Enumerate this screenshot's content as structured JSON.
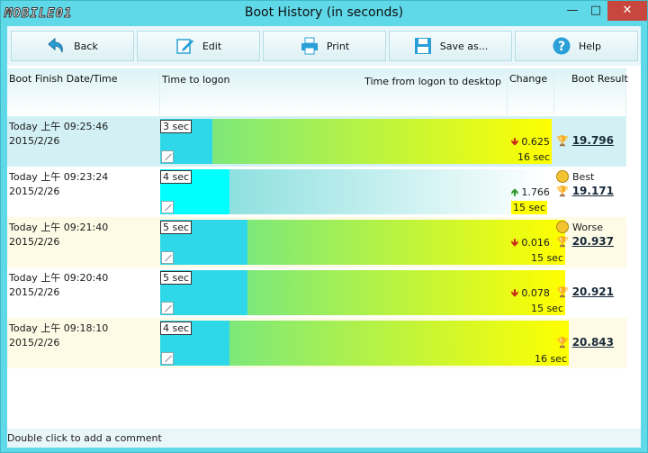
{
  "window": {
    "logo": "MOBILE01",
    "title": "Boot History (in seconds)",
    "min_glyph": "—",
    "max_glyph": "□",
    "close_glyph": "✕"
  },
  "toolbar": {
    "back_label": "Back",
    "edit_label": "Edit",
    "print_label": "Print",
    "save_label": "Save as...",
    "help_label": "Help"
  },
  "header": {
    "date_col": "Boot Finish Date/Time",
    "logon_col": "Time to logon",
    "desktop_col": "Time from logon to desktop",
    "change_col": "Change",
    "result_col": "Boot Result"
  },
  "rows": [
    {
      "day": "Today  上午  09:25:46",
      "date": "2015/2/26",
      "logon": "3 sec",
      "logon_sec": 3,
      "desktop": "16 sec",
      "desktop_sec": 16,
      "change": "0.625",
      "change_dir": "down",
      "tag": "",
      "result": "19.796"
    },
    {
      "day": "Today  上午  09:23:24",
      "date": "2015/2/26",
      "logon": "4 sec",
      "logon_sec": 4,
      "desktop": "15 sec",
      "desktop_sec": 15,
      "change": "1.766",
      "change_dir": "up",
      "tag": "Best",
      "result": "19.171"
    },
    {
      "day": "Today  上午  09:21:40",
      "date": "2015/2/26",
      "logon": "5 sec",
      "logon_sec": 5,
      "desktop": "15 sec",
      "desktop_sec": 15,
      "change": "0.016",
      "change_dir": "down",
      "tag": "Worse",
      "result": "20.937"
    },
    {
      "day": "Today  上午  09:20:40",
      "date": "2015/2/26",
      "logon": "5 sec",
      "logon_sec": 5,
      "desktop": "15 sec",
      "desktop_sec": 15,
      "change": "0.078",
      "change_dir": "down",
      "tag": "",
      "result": "20.921"
    },
    {
      "day": "Today  上午  09:18:10",
      "date": "2015/2/26",
      "logon": "4 sec",
      "logon_sec": 4,
      "desktop": "16 sec",
      "desktop_sec": 16,
      "change": "",
      "change_dir": "",
      "tag": "",
      "result": "20.843"
    }
  ],
  "icons": {
    "back": "back-arrow-icon",
    "edit": "edit-icon",
    "print": "printer-icon",
    "save": "floppy-disk-icon",
    "help": "help-icon",
    "trophy": "trophy-icon",
    "smile": "smiley-icon"
  },
  "colors": {
    "frame": "#5fd8e8",
    "logon_bar": "#2ed8e8",
    "logon_bar_selected": "#00ffff",
    "desktop_bar_start": "#7de87a",
    "desktop_bar_end": "#ffff00",
    "close_button": "#c7463d"
  },
  "status": "Double click to add a comment"
}
